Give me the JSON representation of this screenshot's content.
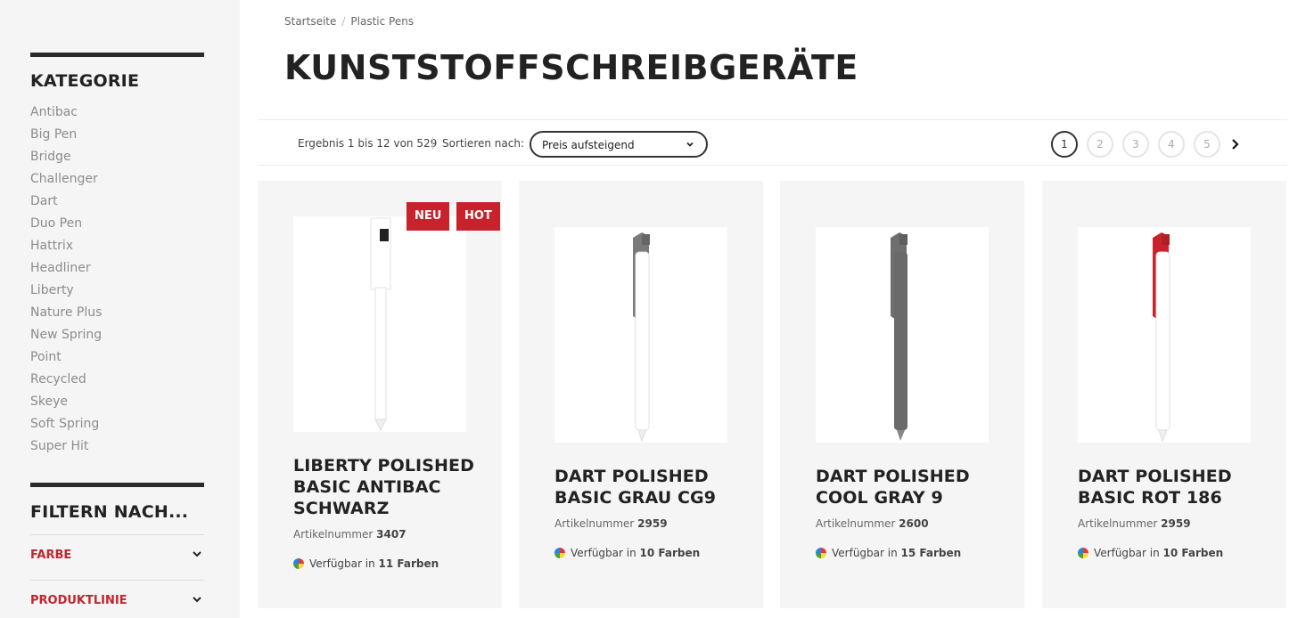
{
  "sidebar": {
    "category_title": "KATEGORIE",
    "categories": [
      "Antibac",
      "Big Pen",
      "Bridge",
      "Challenger",
      "Dart",
      "Duo Pen",
      "Hattrix",
      "Headliner",
      "Liberty",
      "Nature Plus",
      "New Spring",
      "Point",
      "Recycled",
      "Skeye",
      "Soft Spring",
      "Super Hit"
    ],
    "filter_title": "FILTERN NACH...",
    "filters": [
      "FARBE",
      "PRODUKTLINIE"
    ]
  },
  "breadcrumb": [
    "Startseite",
    "Plastic Pens"
  ],
  "page_title": "KUNSTSTOFFSCHREIBGERÄTE",
  "toolbar": {
    "result_text": "Ergebnis 1 bis 12 von 529",
    "sort_label": "Sortieren nach:",
    "sort_value": "Preis aufsteigend"
  },
  "pagination": {
    "pages": [
      "1",
      "2",
      "3",
      "4",
      "5"
    ],
    "active": "1"
  },
  "products": [
    {
      "name": "LIBERTY POLISHED BASIC ANTIBAC SCHWARZ",
      "sku_label": "Artikelnummer",
      "sku": "3407",
      "avail_label": "Verfügbar in",
      "avail": "11 Farben",
      "badges": [
        "NEU",
        "HOT"
      ],
      "pen_clip_color": "#ffffff"
    },
    {
      "name": "DART POLISHED BASIC GRAU CG9",
      "sku_label": "Artikelnummer",
      "sku": "2959",
      "avail_label": "Verfügbar in",
      "avail": "10 Farben",
      "badges": [],
      "pen_clip_color": "#7a7a7a"
    },
    {
      "name": "DART POLISHED COOL GRAY 9",
      "sku_label": "Artikelnummer",
      "sku": "2600",
      "avail_label": "Verfügbar in",
      "avail": "15 Farben",
      "badges": [],
      "pen_clip_color": "#6e6e6e"
    },
    {
      "name": "DART POLISHED BASIC ROT 186",
      "sku_label": "Artikelnummer",
      "sku": "2959",
      "avail_label": "Verfügbar in",
      "avail": "10 Farben",
      "badges": [],
      "pen_clip_color": "#c8232c"
    }
  ],
  "colors": {
    "accent": "#c8232c",
    "sidebar_bg": "#f5f5f5",
    "card_bg": "#f5f5f5"
  }
}
